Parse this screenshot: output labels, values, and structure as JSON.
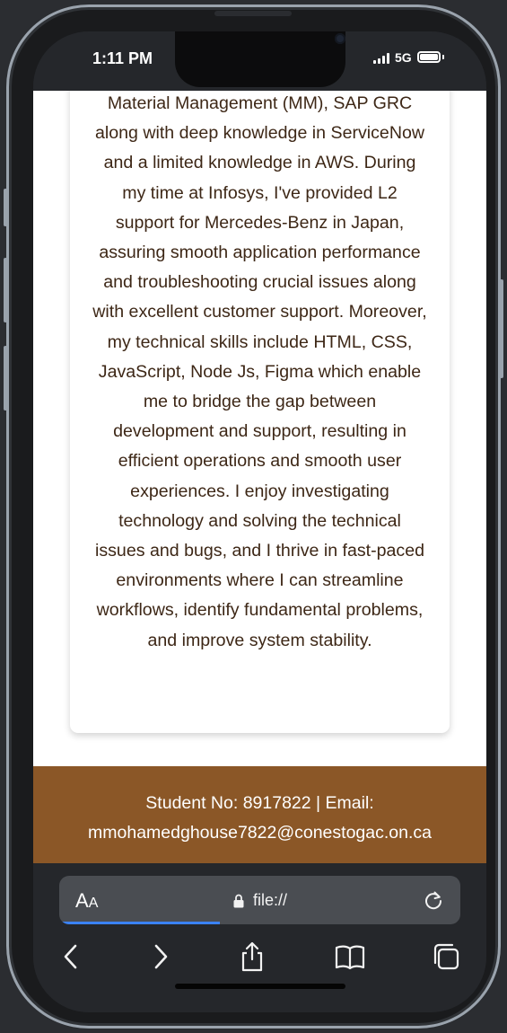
{
  "status_bar": {
    "time": "1:11 PM",
    "network": "5G"
  },
  "about": {
    "text": "Material Management (MM), SAP GRC along with deep knowledge in ServiceNow and a limited knowledge in AWS. During my time at Infosys, I've provided L2 support for Mercedes-Benz in Japan, assuring smooth application performance and troubleshooting crucial issues along with excellent customer support. Moreover, my technical skills include HTML, CSS, JavaScript, Node Js, Figma which enable me to bridge the gap between development and support, resulting in efficient operations and smooth user experiences. I enjoy investigating technology and solving the technical issues and bugs, and I thrive in fast-paced environments where I can streamline workflows, identify fundamental problems, and improve system stability."
  },
  "footer": {
    "line1": "Student No: 8917822 | Email:",
    "line2": "mmohamedghouse7822@conestogac.on.ca"
  },
  "browser": {
    "text_size_label": "A",
    "text_size_label_small": "A",
    "url": "file://",
    "load_progress": 0.4
  },
  "icons": {
    "lock": "lock-icon",
    "reload": "reload-icon",
    "back": "chevron-left-icon",
    "forward": "chevron-right-icon",
    "share": "share-icon",
    "bookmarks": "book-icon",
    "tabs": "tabs-icon"
  },
  "colors": {
    "footer_bg": "#8b5727",
    "body_text": "#3d2716",
    "progress": "#3b82f6"
  }
}
